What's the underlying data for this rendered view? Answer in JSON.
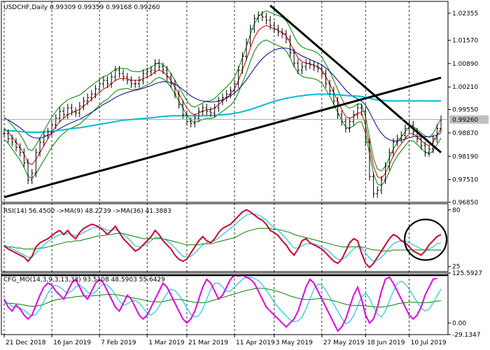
{
  "chart_data": {
    "type": "line",
    "symbol": "USDCHF",
    "timeframe": "Daily",
    "ohlc_header": "USDCHF,Daily  0.99309 0.99359 0.99168 0.99260",
    "x_ticks": [
      "21 Dec 2018",
      "16 Jan 2019",
      "7 Feb 2019",
      "1 Mar 2019",
      "21 Mar 2019",
      "11 Apr 2019",
      "3 May 2019",
      "27 May 2019",
      "18 Jun 2019",
      "10 Jul 2019"
    ],
    "price_panel": {
      "y_ticks": [
        "1.02355",
        "1.01570",
        "1.00890",
        "1.00210",
        "0.99550",
        "0.98870",
        "0.98190",
        "0.97510",
        "0.96850"
      ],
      "ylim": [
        0.9685,
        1.027
      ],
      "current_price": "0.99260",
      "close_series": [
        0.9885,
        0.987,
        0.986,
        0.9845,
        0.983,
        0.98,
        0.975,
        0.977,
        0.983,
        0.986,
        0.988,
        0.989,
        0.991,
        0.993,
        0.995,
        0.994,
        0.996,
        0.995,
        0.9945,
        0.9965,
        0.998,
        0.999,
        1.0,
        1.0015,
        1.003,
        1.004,
        1.003,
        1.005,
        1.007,
        1.006,
        1.005,
        1.004,
        1.003,
        1.003,
        1.004,
        1.006,
        1.0065,
        1.007,
        1.009,
        1.008,
        1.007,
        1.005,
        1.003,
        1.0,
        0.997,
        0.994,
        0.992,
        0.9915,
        0.993,
        0.995,
        0.996,
        0.995,
        0.9945,
        0.996,
        0.998,
        0.999,
        1.0,
        1.001,
        1.003,
        1.007,
        1.011,
        1.015,
        1.019,
        1.022,
        1.023,
        1.0225,
        1.0215,
        1.02,
        1.019,
        1.018,
        1.0175,
        1.016,
        1.012,
        1.009,
        1.007,
        1.008,
        1.009,
        1.0085,
        1.008,
        1.0075,
        1.006,
        1.003,
        1.001,
        0.998,
        0.994,
        0.992,
        0.99,
        0.992,
        0.994,
        0.996,
        0.995,
        0.986,
        0.976,
        0.971,
        0.972,
        0.975,
        0.979,
        0.983,
        0.986,
        0.987,
        0.988,
        0.99,
        0.991,
        0.989,
        0.987,
        0.985,
        0.983,
        0.984,
        0.987,
        0.99,
        0.9926
      ],
      "ma_fast": [
        0.99,
        0.989,
        0.9875,
        0.986,
        0.9845,
        0.9825,
        0.98,
        0.9795,
        0.981,
        0.983,
        0.985,
        0.987,
        0.989,
        0.9905,
        0.992,
        0.993,
        0.994,
        0.9945,
        0.995,
        0.9955,
        0.9965,
        0.9975,
        0.9985,
        0.9995,
        1.0005,
        1.0015,
        1.002,
        1.003,
        1.004,
        1.0045,
        1.0045,
        1.0045,
        1.004,
        1.004,
        1.004,
        1.0045,
        1.005,
        1.0055,
        1.0065,
        1.007,
        1.0065,
        1.0055,
        1.004,
        1.002,
        1.0,
        0.998,
        0.996,
        0.9945,
        0.994,
        0.9945,
        0.995,
        0.9955,
        0.9955,
        0.996,
        0.997,
        0.998,
        0.999,
        1.0,
        1.0015,
        1.004,
        1.007,
        1.01,
        1.0135,
        1.0165,
        1.0185,
        1.0195,
        1.02,
        1.0195,
        1.019,
        1.0185,
        1.018,
        1.017,
        1.015,
        1.0125,
        1.0105,
        1.0095,
        1.009,
        1.0088,
        1.0085,
        1.008,
        1.007,
        1.005,
        1.003,
        1.0005,
        0.998,
        0.9955,
        0.9935,
        0.993,
        0.9935,
        0.9945,
        0.9945,
        0.991,
        0.985,
        0.979,
        0.976,
        0.9755,
        0.977,
        0.9795,
        0.982,
        0.984,
        0.9855,
        0.987,
        0.9885,
        0.9885,
        0.9875,
        0.9865,
        0.9855,
        0.985,
        0.986,
        0.988,
        0.99
      ],
      "ma_slow": [
        0.993,
        0.9925,
        0.9918,
        0.991,
        0.9902,
        0.9893,
        0.9882,
        0.9875,
        0.9872,
        0.9872,
        0.9875,
        0.988,
        0.9886,
        0.9893,
        0.99,
        0.9906,
        0.9912,
        0.9917,
        0.9922,
        0.9927,
        0.9933,
        0.994,
        0.9947,
        0.9954,
        0.9962,
        0.997,
        0.9976,
        0.9983,
        0.999,
        0.9996,
        1.0001,
        1.0005,
        1.0008,
        1.0011,
        1.0014,
        1.0017,
        1.0021,
        1.0025,
        1.003,
        1.0034,
        1.0036,
        1.0036,
        1.0034,
        1.0029,
        1.0022,
        1.0013,
        1.0004,
        0.9995,
        0.9988,
        0.9983,
        0.998,
        0.9978,
        0.9977,
        0.9978,
        0.998,
        0.9984,
        0.9989,
        0.9995,
        1.0003,
        1.0014,
        1.0027,
        1.0042,
        1.0058,
        1.0075,
        1.009,
        1.0103,
        1.0114,
        1.0122,
        1.0128,
        1.0132,
        1.0134,
        1.0134,
        1.0131,
        1.0125,
        1.0118,
        1.0111,
        1.0106,
        1.0101,
        1.0096,
        1.0091,
        1.0085,
        1.0076,
        1.0066,
        1.0054,
        1.004,
        1.0026,
        1.0012,
        1.0001,
        0.9992,
        0.9986,
        0.998,
        0.9968,
        0.9948,
        0.9925,
        0.9903,
        0.9886,
        0.9874,
        0.9867,
        0.9864,
        0.9864,
        0.9866,
        0.9869,
        0.9873,
        0.9876,
        0.9877,
        0.9877,
        0.9876,
        0.9875,
        0.9877,
        0.9881,
        0.9887
      ],
      "ma_long": [
        0.9895,
        0.9894,
        0.9893,
        0.9892,
        0.9891,
        0.989,
        0.9889,
        0.9889,
        0.9889,
        0.9889,
        0.989,
        0.9891,
        0.9892,
        0.9893,
        0.9895,
        0.9896,
        0.9898,
        0.9899,
        0.9901,
        0.9902,
        0.9904,
        0.9906,
        0.9908,
        0.991,
        0.9912,
        0.9914,
        0.9916,
        0.9918,
        0.992,
        0.9922,
        0.9924,
        0.9925,
        0.9926,
        0.9927,
        0.9928,
        0.9929,
        0.993,
        0.9931,
        0.9932,
        0.9934,
        0.9935,
        0.9936,
        0.9937,
        0.9937,
        0.9937,
        0.9937,
        0.9937,
        0.9937,
        0.9937,
        0.9937,
        0.9937,
        0.9937,
        0.9938,
        0.9938,
        0.9939,
        0.994,
        0.9941,
        0.9942,
        0.9944,
        0.9946,
        0.9949,
        0.9952,
        0.9955,
        0.9959,
        0.9963,
        0.9967,
        0.9971,
        0.9975,
        0.9979,
        0.9982,
        0.9985,
        0.9988,
        0.999,
        0.9992,
        0.9994,
        0.9995,
        0.9997,
        0.9998,
        0.9999,
        1.0,
        1.0,
        1.0,
        1.0,
        0.9999,
        0.9998,
        0.9997,
        0.9996,
        0.9995,
        0.9995,
        0.9994,
        0.9993,
        0.9991,
        0.9988,
        0.9985,
        0.9983,
        0.9982,
        0.9981,
        0.998,
        0.998,
        0.998,
        0.998,
        0.998,
        0.998,
        0.998,
        0.998,
        0.998,
        0.998,
        0.998,
        0.998,
        0.998,
        0.998
      ]
    },
    "rsi_panel": {
      "label": "RSI(14) 56.4500 ->MA(9) 48.2739 ->MA(36) 41.3883",
      "y_ticks": [
        "80",
        "25"
      ],
      "ylim": [
        20,
        86
      ],
      "rsi": [
        45,
        42,
        40,
        38,
        36,
        34,
        30,
        35,
        44,
        48,
        50,
        52,
        55,
        58,
        60,
        56,
        60,
        55,
        52,
        58,
        62,
        64,
        66,
        65,
        63,
        60,
        56,
        60,
        64,
        58,
        52,
        48,
        44,
        40,
        42,
        46,
        50,
        54,
        60,
        56,
        50,
        46,
        42,
        36,
        32,
        30,
        32,
        38,
        44,
        50,
        54,
        50,
        48,
        52,
        58,
        62,
        64,
        66,
        70,
        74,
        78,
        80,
        78,
        75,
        72,
        70,
        66,
        60,
        58,
        55,
        50,
        46,
        40,
        36,
        42,
        50,
        52,
        48,
        46,
        44,
        42,
        38,
        34,
        30,
        28,
        32,
        40,
        48,
        52,
        50,
        38,
        28,
        24,
        28,
        34,
        40,
        46,
        52,
        56,
        54,
        50,
        48,
        44,
        40,
        38,
        36,
        40,
        46,
        50,
        54,
        56
      ],
      "ma_fast": [
        46,
        44,
        42,
        40,
        38,
        36,
        34,
        34,
        38,
        42,
        46,
        49,
        52,
        54,
        56,
        56,
        57,
        56,
        55,
        56,
        58,
        60,
        62,
        63,
        63,
        62,
        60,
        60,
        61,
        59,
        56,
        53,
        49,
        45,
        44,
        45,
        47,
        50,
        53,
        53,
        52,
        50,
        47,
        43,
        39,
        35,
        34,
        35,
        38,
        42,
        46,
        48,
        49,
        50,
        53,
        56,
        59,
        62,
        65,
        69,
        72,
        75,
        76,
        76,
        75,
        73,
        70,
        66,
        63,
        60,
        56,
        52,
        47,
        43,
        43,
        45,
        47,
        47,
        47,
        46,
        44,
        42,
        39,
        35,
        32,
        32,
        34,
        38,
        42,
        45,
        43,
        38,
        33,
        30,
        31,
        34,
        38,
        43,
        47,
        49,
        50,
        50,
        48,
        46,
        44,
        42,
        41,
        42,
        44,
        47,
        48
      ],
      "ma_slow": [
        44,
        44,
        44,
        43,
        43,
        42,
        42,
        42,
        42,
        43,
        43,
        44,
        45,
        46,
        47,
        48,
        49,
        49,
        50,
        50,
        51,
        52,
        53,
        54,
        55,
        55,
        56,
        56,
        57,
        57,
        57,
        56,
        55,
        54,
        53,
        52,
        52,
        52,
        52,
        52,
        52,
        51,
        50,
        49,
        48,
        47,
        46,
        46,
        46,
        46,
        47,
        47,
        47,
        48,
        49,
        50,
        51,
        52,
        53,
        55,
        57,
        59,
        60,
        61,
        62,
        62,
        62,
        62,
        61,
        61,
        60,
        59,
        58,
        56,
        55,
        54,
        53,
        52,
        51,
        50,
        49,
        48,
        47,
        46,
        45,
        44,
        44,
        44,
        44,
        44,
        44,
        43,
        42,
        41,
        41,
        40,
        40,
        40,
        41,
        41,
        41,
        41,
        41,
        41,
        41,
        41,
        41,
        41,
        41,
        41,
        41
      ]
    },
    "cfg_panel": {
      "label": "CFG_MO(14,3,9,3,13,33) 93.5108 48.5903 55.6429",
      "y_ticks": [
        "125.5927",
        "0.00",
        "-29.1347"
      ],
      "ylim": [
        -29.1347,
        125.5927
      ],
      "level_line": 120,
      "mo": [
        60,
        40,
        30,
        45,
        35,
        20,
        10,
        20,
        45,
        70,
        90,
        100,
        95,
        80,
        70,
        60,
        80,
        100,
        110,
        90,
        70,
        60,
        80,
        100,
        110,
        100,
        80,
        60,
        40,
        30,
        50,
        70,
        60,
        40,
        20,
        10,
        20,
        40,
        60,
        80,
        100,
        90,
        70,
        50,
        30,
        10,
        0,
        10,
        30,
        60,
        90,
        110,
        100,
        80,
        60,
        70,
        90,
        110,
        120,
        118,
        120,
        115,
        110,
        100,
        80,
        60,
        40,
        30,
        20,
        10,
        0,
        -10,
        0,
        10,
        30,
        60,
        90,
        110,
        100,
        80,
        60,
        40,
        20,
        0,
        -20,
        -10,
        10,
        40,
        70,
        90,
        60,
        20,
        0,
        10,
        40,
        80,
        110,
        115,
        100,
        80,
        60,
        40,
        20,
        10,
        20,
        40,
        70,
        90,
        110,
        112
      ],
      "sig1": [
        55,
        50,
        42,
        40,
        38,
        32,
        24,
        18,
        22,
        35,
        55,
        75,
        90,
        95,
        90,
        82,
        75,
        80,
        90,
        95,
        88,
        78,
        72,
        78,
        90,
        98,
        95,
        85,
        70,
        55,
        45,
        48,
        55,
        57,
        50,
        38,
        25,
        20,
        28,
        42,
        58,
        75,
        85,
        82,
        70,
        55,
        38,
        22,
        15,
        18,
        35,
        60,
        85,
        100,
        100,
        90,
        80,
        80,
        90,
        100,
        110,
        115,
        115,
        112,
        106,
        96,
        82,
        68,
        52,
        40,
        28,
        18,
        8,
        3,
        5,
        15,
        35,
        60,
        85,
        98,
        95,
        82,
        65,
        47,
        30,
        12,
        -2,
        3,
        18,
        42,
        65,
        75,
        62,
        40,
        22,
        15,
        30,
        55,
        80,
        100,
        105,
        98,
        85,
        68,
        52,
        38,
        30,
        35,
        50,
        68,
        85
      ],
      "sig2": [
        50,
        50,
        49,
        48,
        47,
        45,
        43,
        42,
        42,
        44,
        47,
        51,
        55,
        58,
        60,
        62,
        63,
        64,
        66,
        67,
        68,
        68,
        68,
        69,
        70,
        71,
        72,
        72,
        71,
        70,
        68,
        66,
        64,
        62,
        60,
        58,
        56,
        54,
        53,
        53,
        54,
        56,
        58,
        59,
        59,
        58,
        56,
        54,
        52,
        51,
        51,
        52,
        55,
        58,
        61,
        64,
        67,
        70,
        73,
        76,
        79,
        82,
        84,
        86,
        87,
        87,
        86,
        84,
        82,
        79,
        76,
        72,
        68,
        65,
        62,
        60,
        59,
        59,
        60,
        61,
        61,
        60,
        58,
        56,
        53,
        50,
        47,
        45,
        44,
        44,
        44,
        43,
        42,
        41,
        40,
        40,
        41,
        43,
        45,
        48,
        50,
        51,
        52,
        52,
        52,
        51,
        51,
        52,
        53,
        55,
        56
      ]
    },
    "trendlines": [
      {
        "from": [
          0,
          0.97
        ],
        "to": [
          110,
          1.0048
        ]
      },
      {
        "from": [
          67,
          1.0258
        ],
        "to": [
          110,
          0.983
        ]
      }
    ],
    "colors": {
      "price": "#000000",
      "ma_fast": "#cc0000",
      "ma_slow": "#00008b",
      "ma_long": "#00bcd4",
      "bands": "#008000",
      "rsi": "#cc0033",
      "rsi_ma_fast": "#00bcd4",
      "rsi_ma_slow": "#008000",
      "mo": "#e000e0",
      "mo_sig1": "#00bcd4",
      "mo_sig2": "#008000",
      "current_price_box": "#c0c0c0"
    },
    "grid": "vertical-dashed"
  }
}
